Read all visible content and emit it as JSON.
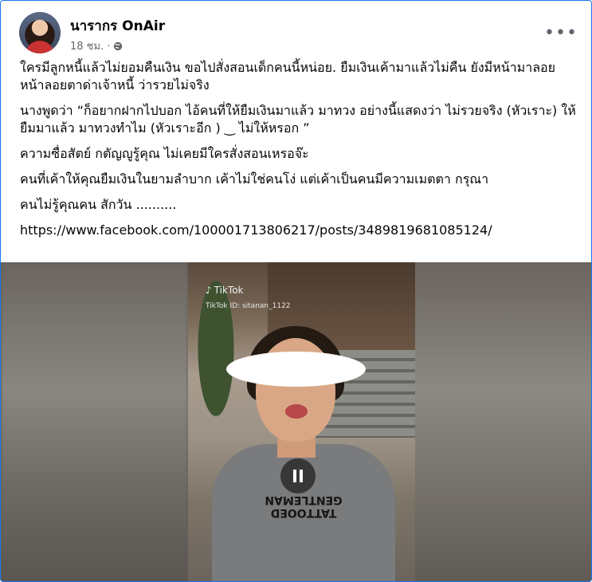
{
  "post": {
    "author": "นารากร OnAir",
    "timestamp": "18 ชม. ·",
    "audience_icon": "globe-icon",
    "more_label": "•••",
    "paragraphs": [
      "ใครมีลูกหนี้แล้วไม่ยอมคืนเงิน ขอไปสั่งสอนเด็กคนนี้หน่อย. ยืมเงินเค้ามาแล้วไม่คืน ยังมีหน้ามาลอยหน้าลอยตาด่าเจ้าหนี้ ว่ารวยไม่จริง",
      "นางพูดว่า  “ก็อยากฝากไปบอก ไอ้คนที่ให้ยืมเงินมาแล้ว  มาทวง อย่างนี้แสดงว่า ไม่รวยจริง (หัวเราะ)  ให้ยืมมาแล้ว มาทวงทำไม (หัวเราะอีก )  ‿ ไม่ให้หรอก ”",
      "ความซื่อสัตย์ กตัญญูรู้คุณ ไม่เคยมีใครสั่งสอนเหรอจ๊ะ",
      "คนที่เค้าให้คุณยืมเงินในยามลำบาก เค้าไม่ใช่คนโง่ แต่เค้าเป็นคนมีความเมตตา กรุณา",
      "คนไม่รู้คุณคน สักวัน .........."
    ],
    "link": "https://www.facebook.com/100001713806217/posts/3489819681085124/"
  },
  "video": {
    "watermark_logo": "TikTok",
    "watermark_id": "TikTok ID: sitanan_1122",
    "shirt_text": "TATTOOED GENTLEMAN",
    "pause_icon": "pause-icon"
  },
  "colors": {
    "frame_border": "#1877f2",
    "text": "#050505",
    "meta": "#65676b"
  }
}
